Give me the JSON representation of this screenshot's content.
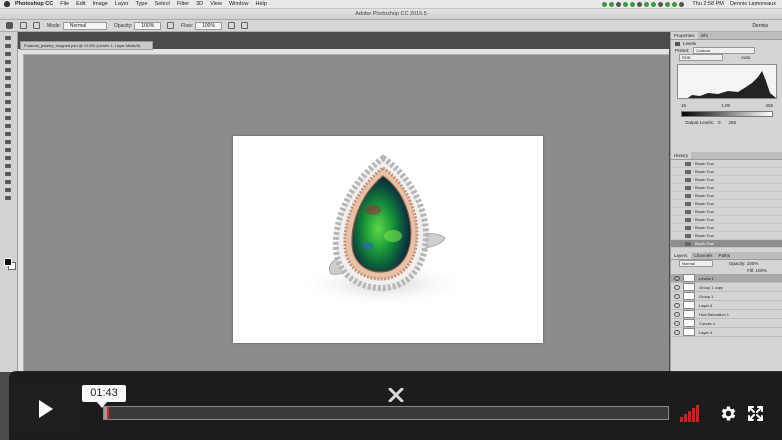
{
  "menubar": {
    "app": "Photoshop CC",
    "items": [
      "File",
      "Edit",
      "Image",
      "Layer",
      "Type",
      "Select",
      "Filter",
      "3D",
      "View",
      "Window",
      "Help"
    ],
    "clock": "Thu 2:58 PM",
    "user": "Dennis Lamoreaux"
  },
  "window": {
    "title": "Adobe Photoshop CC 2015.5"
  },
  "options": {
    "mode_label": "Mode:",
    "mode_value": "Normal",
    "opacity_label": "Opacity:",
    "opacity_value": "100%",
    "flow_label": "Flow:",
    "flow_value": "100%",
    "workspace": "Dennis"
  },
  "document": {
    "tab_label": "Polaroid_jewelry_cropped.psd @ 12.5% (Levels 1, Layer Mask/8)"
  },
  "panels": {
    "tabs": [
      "Properties",
      "Info"
    ],
    "properties_title": "Levels",
    "preset_label": "Preset:",
    "preset_value": "Custom",
    "channel_value": "RGB",
    "auto_label": "Auto",
    "input_values": [
      "15",
      "1.00",
      "255"
    ],
    "output_label": "Output Levels:",
    "output_values": [
      "0",
      "255"
    ],
    "history_tab": "History",
    "history_items": [
      "Brush Tool",
      "Brush Tool",
      "Brush Tool",
      "Brush Tool",
      "Brush Tool",
      "Brush Tool",
      "Brush Tool",
      "Brush Tool",
      "Brush Tool",
      "Brush Tool",
      "Brush Tool"
    ],
    "layers_tabs": [
      "Layers",
      "Channels",
      "Paths"
    ],
    "blend_value": "Normal",
    "opacity_row": "Opacity: 100%",
    "fill_row": "Fill: 100%",
    "layers": [
      "Levels 1",
      "Group 1 copy",
      "Group 1",
      "Layer 6",
      "Hue/Saturation 1",
      "Curves 4",
      "Layer 4"
    ]
  },
  "player": {
    "timecode": "01:43",
    "progress": 0.005,
    "icons": [
      "play-icon",
      "close-icon",
      "volume-icon",
      "gear-icon",
      "fullscreen-icon"
    ],
    "accent_color": "#d81b1b"
  }
}
